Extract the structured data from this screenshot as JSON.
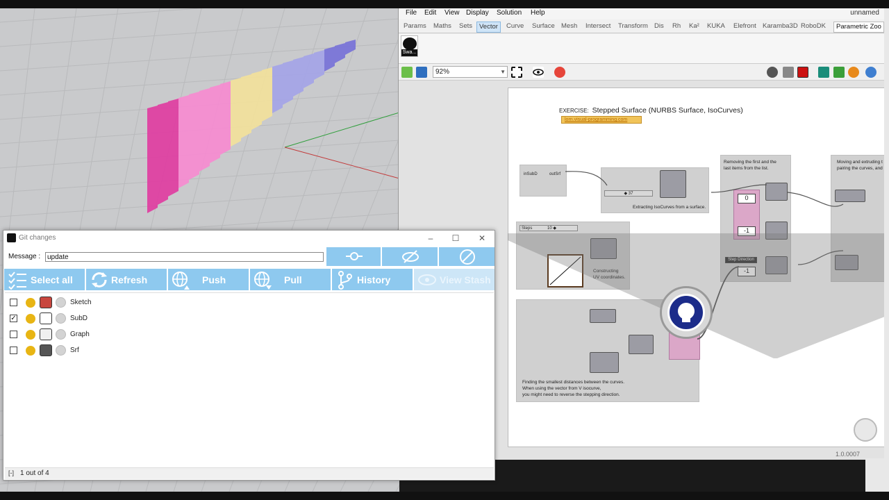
{
  "rhino_viewport": {
    "axes_colors": {
      "x": "#c23a3a",
      "y": "#2f9e3b"
    },
    "gradient_colors": [
      "#e03aa0",
      "#f78ad0",
      "#f3e19a",
      "#a3a3e8",
      "#7670d8"
    ]
  },
  "grasshopper": {
    "menu": [
      "File",
      "Edit",
      "View",
      "Display",
      "Solution",
      "Help"
    ],
    "document_name": "unnamed",
    "tabs": [
      "Params",
      "Maths",
      "Sets",
      "Vector",
      "Curve",
      "Surface",
      "Mesh",
      "Intersect",
      "Transform",
      "Dis",
      "Rh",
      "Ka²",
      "KUKA",
      "Elefront",
      "Karamba3D",
      "RoboDK",
      "Parametric Zoo"
    ],
    "active_tab": "Vector",
    "ribbon_button_label": "Swa...",
    "zoom_value": "92%",
    "version": "1.0.0007",
    "exercise": {
      "prefix": "EXERCISE:",
      "title": "Stepped Surface (NURBS Surface, IsoCurves)",
      "link": "lorn.visual-programming.com"
    },
    "groups": [
      {
        "text": "Extracting IsoCurves from a surface."
      },
      {
        "text": "Removing the first and the\nlast items from the list."
      },
      {
        "text": "Moving and extruding t\npairing the curves, and"
      },
      {
        "text": "Constructing\nUV coordinates."
      },
      {
        "text": "Finding the smallest distances between the curves.\nWhen using the vector from V isocurve,\nyou might need to reverse the stepping direction."
      }
    ],
    "panels": [
      "0",
      "-1",
      "-1"
    ],
    "labels": {
      "steps": "Steps",
      "steps_value": "10 ◆",
      "n_value": "◆ 37",
      "step_direction": "Step Direction",
      "in_subd": "inSubD",
      "out_srf": "outSrf"
    }
  },
  "git_window": {
    "title": "Git changes",
    "message_label": "Message :",
    "message_value": "update",
    "actions": [
      {
        "label": "Select all",
        "icon": "select-all-icon"
      },
      {
        "label": "Refresh",
        "icon": "refresh-icon"
      },
      {
        "label": "Push",
        "icon": "push-icon"
      },
      {
        "label": "Pull",
        "icon": "pull-icon"
      },
      {
        "label": "History",
        "icon": "history-icon"
      },
      {
        "label": "View Stash",
        "icon": "eye-icon"
      }
    ],
    "top_tools": [
      {
        "icon": "commit-icon"
      },
      {
        "icon": "hide-icon"
      },
      {
        "icon": "discard-icon"
      }
    ],
    "files": [
      {
        "name": "Sketch",
        "checked": false,
        "check_mark": ""
      },
      {
        "name": "SubD",
        "checked": true,
        "check_mark": "✓"
      },
      {
        "name": "Graph",
        "checked": false,
        "check_mark": ""
      },
      {
        "name": "Srf",
        "checked": false,
        "check_mark": ""
      }
    ],
    "status": {
      "collapse": "[-]",
      "count": "1 out of 4"
    },
    "colors": {
      "button_bg": "#8ec9ef",
      "pencil": "#e8b514"
    }
  }
}
